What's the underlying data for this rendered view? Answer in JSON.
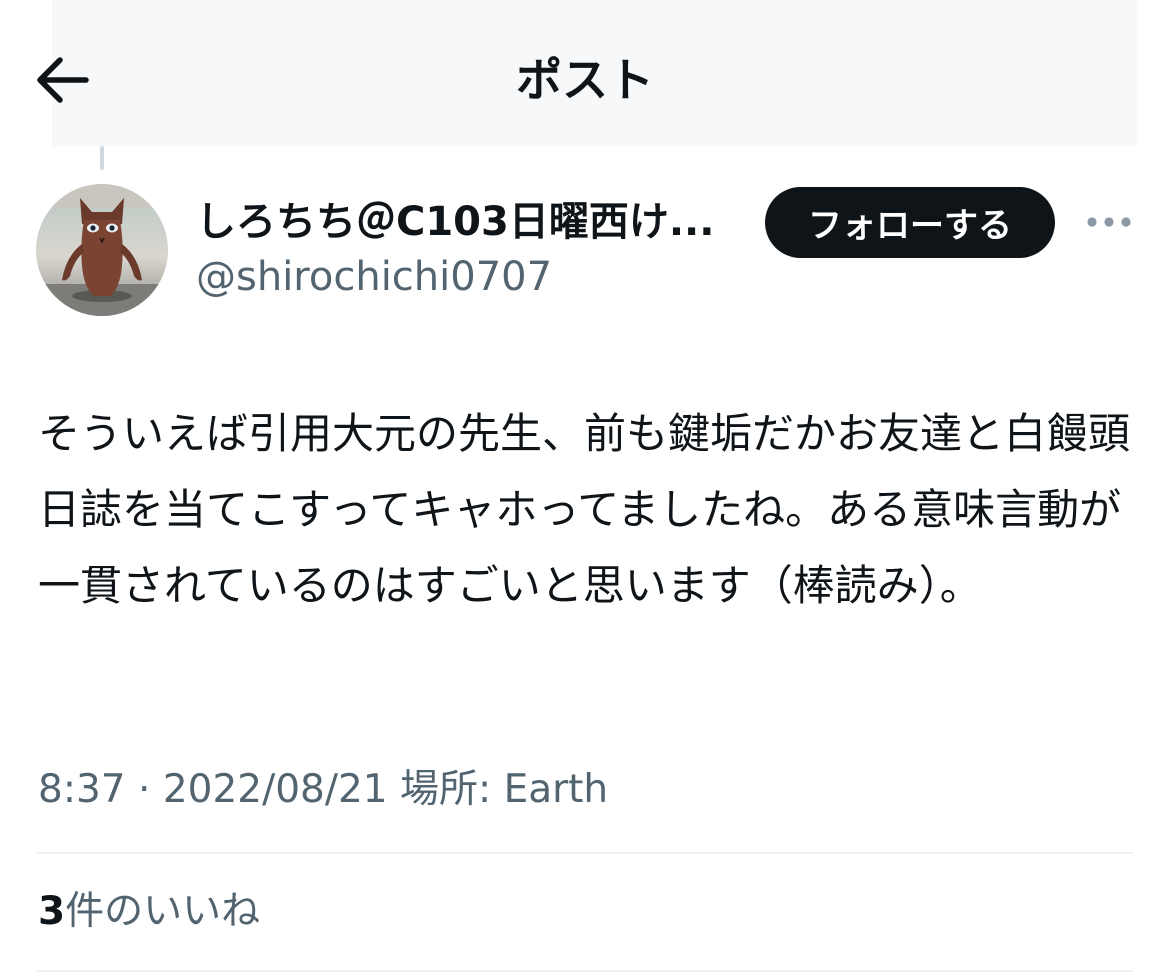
{
  "header": {
    "title": "ポスト",
    "back_icon": "arrow-left-icon"
  },
  "author": {
    "display_name": "しろちち＠C103日曜西け...",
    "username": "@shirochichi0707",
    "avatar_icon": "cat-figure-avatar",
    "follow_label": "フォローする",
    "more_icon": "more-horizontal-icon"
  },
  "post": {
    "text": "そういえば引用大元の先生、前も鍵垢だかお友達と白饅頭日誌を当てこすってキャホってましたね。ある意味言動が一貫されているのはすごいと思います（棒読み）。",
    "time": "8:37",
    "separator": "·",
    "date": "2022/08/21",
    "location_label": "場所:",
    "location": "Earth"
  },
  "stats": {
    "likes_count": "3",
    "likes_label": "件のいいね"
  },
  "colors": {
    "primary_text": "#0f1419",
    "secondary_text": "#536471",
    "divider": "#eff3f4",
    "follow_button_bg": "#0f1419"
  }
}
